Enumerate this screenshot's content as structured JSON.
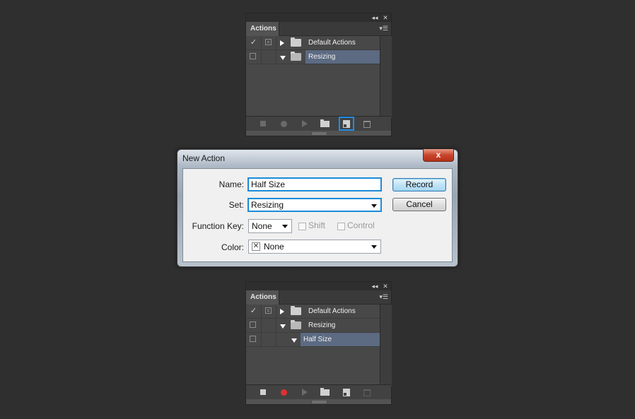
{
  "panel_top": {
    "tab_label": "Actions",
    "rows": [
      {
        "check": "✓",
        "dialog": "filled",
        "expander": "right",
        "label": "Default Actions",
        "selected": false
      },
      {
        "check": "",
        "dialog": "empty",
        "expander": "down",
        "label": "Resizing",
        "selected": true
      }
    ]
  },
  "panel_bottom": {
    "tab_label": "Actions",
    "rows": [
      {
        "check": "✓",
        "dialog": "filled",
        "expander": "right",
        "label": "Default Actions",
        "selected": false
      },
      {
        "check": "",
        "dialog": "empty",
        "expander": "down",
        "label": "Resizing",
        "selected": false
      },
      {
        "check": "",
        "dialog": "empty",
        "expander": "down",
        "label": "Half Size",
        "selected": true
      }
    ],
    "recording": true
  },
  "dialog": {
    "title": "New Action",
    "close_glyph": "x",
    "name_label": "Name:",
    "name_value": "Half Size",
    "set_label": "Set:",
    "set_value": "Resizing",
    "function_key_label": "Function Key:",
    "function_key_value": "None",
    "shift_label": "Shift",
    "control_label": "Control",
    "color_label": "Color:",
    "color_value": "None",
    "record_label": "Record",
    "cancel_label": "Cancel"
  },
  "colors": {
    "highlight_outline": "#1e8ce6",
    "selected_row": "#5c6a82",
    "record_active": "#e03030"
  }
}
